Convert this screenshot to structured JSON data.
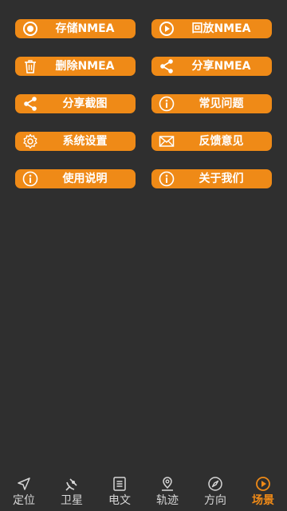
{
  "colors": {
    "background": "#2f2f2f",
    "button": "#ef8a17",
    "button_text": "#ffffff",
    "tab_text": "#d6d6d6",
    "tab_active": "#ef8a17"
  },
  "menu": {
    "save_nmea": {
      "label": "存储NMEA",
      "icon": "record-icon"
    },
    "replay_nmea": {
      "label": "回放NMEA",
      "icon": "play-icon"
    },
    "delete_nmea": {
      "label": "删除NMEA",
      "icon": "trash-icon"
    },
    "share_nmea": {
      "label": "分享NMEA",
      "icon": "share-icon"
    },
    "share_screenshot": {
      "label": "分享截图",
      "icon": "share-icon"
    },
    "faq": {
      "label": "常见问题",
      "icon": "info-icon"
    },
    "settings": {
      "label": "系统设置",
      "icon": "gear-icon"
    },
    "feedback": {
      "label": "反馈意见",
      "icon": "mail-icon"
    },
    "instructions": {
      "label": "使用说明",
      "icon": "info-icon"
    },
    "about": {
      "label": "关于我们",
      "icon": "info-icon"
    }
  },
  "tabbar": {
    "active": "scene",
    "items": [
      {
        "key": "location",
        "label": "定位",
        "icon": "navigation-arrow-icon"
      },
      {
        "key": "satellite",
        "label": "卫星",
        "icon": "satellite-icon"
      },
      {
        "key": "message",
        "label": "电文",
        "icon": "document-icon"
      },
      {
        "key": "track",
        "label": "轨迹",
        "icon": "map-pin-icon"
      },
      {
        "key": "direction",
        "label": "方向",
        "icon": "compass-icon"
      },
      {
        "key": "scene",
        "label": "场景",
        "icon": "play-circle-icon"
      }
    ]
  }
}
